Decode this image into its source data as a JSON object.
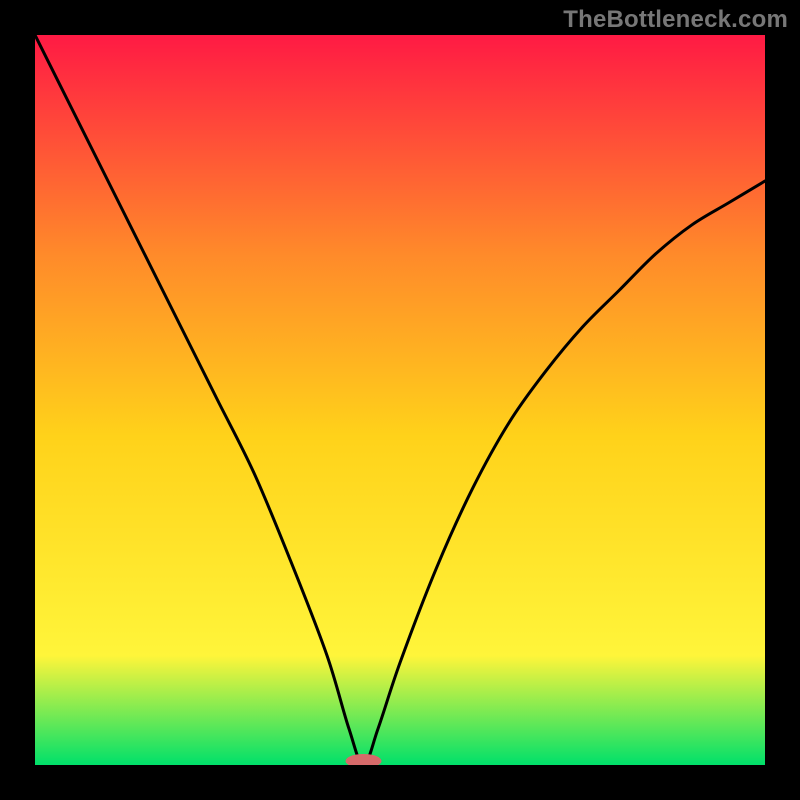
{
  "watermark": "TheBottleneck.com",
  "chart_data": {
    "type": "line",
    "title": "",
    "xlabel": "",
    "ylabel": "",
    "xlim": [
      0,
      100
    ],
    "ylim": [
      0,
      100
    ],
    "grid": false,
    "legend": false,
    "colors": {
      "gradient_top": "#ff1a44",
      "gradient_mid_upper": "#ff8a2a",
      "gradient_mid": "#ffd21a",
      "gradient_mid_lower": "#fff53a",
      "gradient_bottom": "#00e06a",
      "curve": "#000000",
      "marker": "#d66a6a",
      "background": "#000000"
    },
    "marker": {
      "x": 45,
      "y": 0
    },
    "series": [
      {
        "name": "bottleneck-curve",
        "x": [
          0,
          5,
          10,
          15,
          20,
          25,
          30,
          35,
          40,
          43,
          45,
          47,
          50,
          55,
          60,
          65,
          70,
          75,
          80,
          85,
          90,
          95,
          100
        ],
        "values": [
          100,
          90,
          80,
          70,
          60,
          50,
          40,
          28,
          15,
          5,
          0,
          5,
          14,
          27,
          38,
          47,
          54,
          60,
          65,
          70,
          74,
          77,
          80
        ]
      }
    ]
  }
}
